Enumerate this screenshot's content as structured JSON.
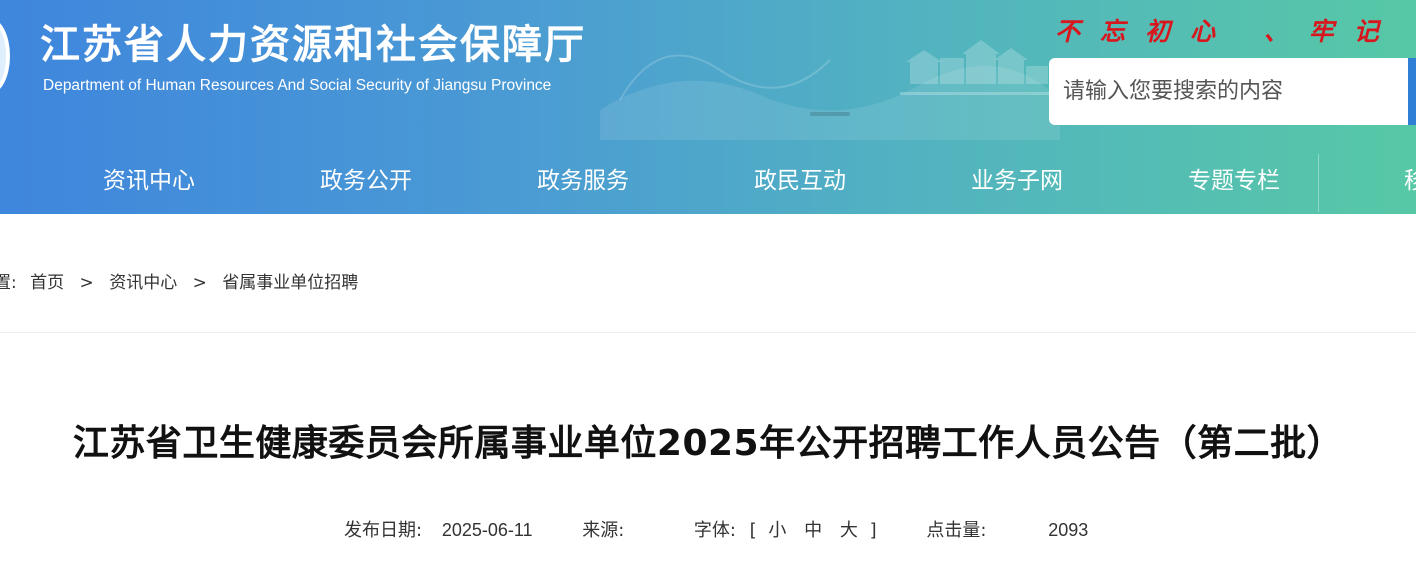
{
  "header": {
    "title": "江苏省人力资源和社会保障厅",
    "subtitle": "Department of Human Resources And Social Security of Jiangsu Province",
    "slogan": "不忘初心 、牢记",
    "search_placeholder": "请输入您要搜索的内容"
  },
  "nav": {
    "items": [
      "资讯中心",
      "政务公开",
      "政务服务",
      "政民互动",
      "业务子网",
      "专题专栏",
      "移"
    ]
  },
  "breadcrumb": {
    "prefix": "置:",
    "items": [
      "首页",
      "资讯中心",
      "省属事业单位招聘"
    ],
    "separator": ">"
  },
  "article": {
    "title": "江苏省卫生健康委员会所属事业单位2025年公开招聘工作人员公告（第二批）",
    "date_label": "发布日期:",
    "date": "2025-06-11",
    "source_label": "来源:",
    "source": "",
    "font_label": "字体:",
    "font_open": "[",
    "font_small": "小",
    "font_medium": "中",
    "font_large": "大",
    "font_close": "]",
    "views_label": "点击量:",
    "views": "2093"
  },
  "colors": {
    "header_start": "#3f86dd",
    "header_end": "#57c8a6",
    "slogan": "#d8161d"
  }
}
